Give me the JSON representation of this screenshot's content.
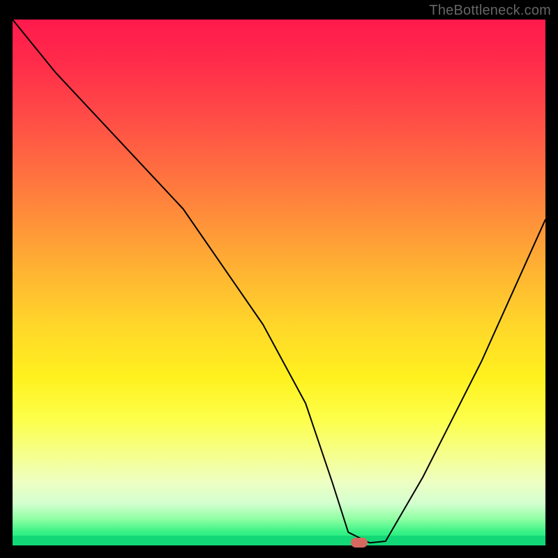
{
  "watermark": "TheBottleneck.com",
  "chart_data": {
    "type": "line",
    "title": "",
    "xlabel": "",
    "ylabel": "",
    "xlim": [
      0,
      100
    ],
    "ylim": [
      0,
      100
    ],
    "grid": false,
    "legend": false,
    "background_gradient": {
      "top": "#ff1a4d",
      "mid": "#ffd62a",
      "bottom": "#13e27a"
    },
    "series": [
      {
        "name": "bottleneck-curve",
        "color": "#000000",
        "x": [
          0,
          8,
          20,
          32,
          47,
          55,
          60,
          63,
          67,
          70,
          77,
          88,
          100
        ],
        "values": [
          100,
          90,
          77,
          64,
          42,
          27,
          12,
          2.5,
          0.5,
          0.8,
          13,
          35,
          62
        ]
      }
    ],
    "marker": {
      "name": "optimal-point",
      "x": 65,
      "y": 0.5,
      "color": "#d7685f"
    }
  }
}
